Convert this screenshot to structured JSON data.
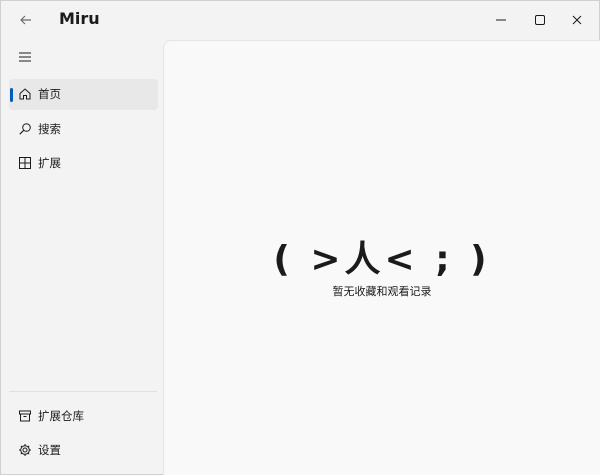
{
  "app": {
    "title": "Miru"
  },
  "titlebar": {
    "back_icon": "arrow-left-icon",
    "minimize_icon": "minimize-icon",
    "maximize_icon": "maximize-icon",
    "close_icon": "close-icon"
  },
  "sidebar": {
    "menu_icon": "hamburger-icon",
    "items": [
      {
        "label": "首页",
        "icon": "home-icon",
        "selected": true
      },
      {
        "label": "搜索",
        "icon": "search-icon",
        "selected": false
      },
      {
        "label": "扩展",
        "icon": "grid-icon",
        "selected": false
      }
    ],
    "footer_items": [
      {
        "label": "扩展仓库",
        "icon": "archive-icon"
      },
      {
        "label": "设置",
        "icon": "gear-icon"
      }
    ],
    "accent_color": "#005fb8"
  },
  "main": {
    "empty_state": {
      "kaomoji": "( >人< ; )",
      "message": "暂无收藏和观看记录"
    }
  }
}
